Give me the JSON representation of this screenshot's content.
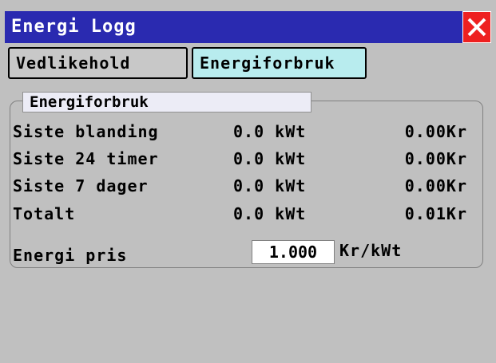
{
  "window": {
    "title": "Energi Logg",
    "close_icon": "close-icon",
    "colors": {
      "titlebar": "#2a2ab0",
      "close": "#ee2020",
      "active_tab": "#b8ecee"
    }
  },
  "tabs": [
    {
      "label": "Vedlikehold",
      "active": false
    },
    {
      "label": "Energiforbruk",
      "active": true
    }
  ],
  "group": {
    "title": "Energiforbruk",
    "rows": [
      {
        "label": "Siste blanding",
        "kwh": "0.0 kWt",
        "kr": "0.00Kr"
      },
      {
        "label": "Siste 24 timer",
        "kwh": "0.0 kWt",
        "kr": "0.00Kr"
      },
      {
        "label": "Siste 7 dager",
        "kwh": "0.0 kWt",
        "kr": "0.00Kr"
      },
      {
        "label": "Totalt",
        "kwh": "0.0 kWt",
        "kr": "0.01Kr"
      }
    ],
    "price": {
      "label": "Energi pris",
      "value": "1.000",
      "unit": "Kr/kWt"
    }
  }
}
